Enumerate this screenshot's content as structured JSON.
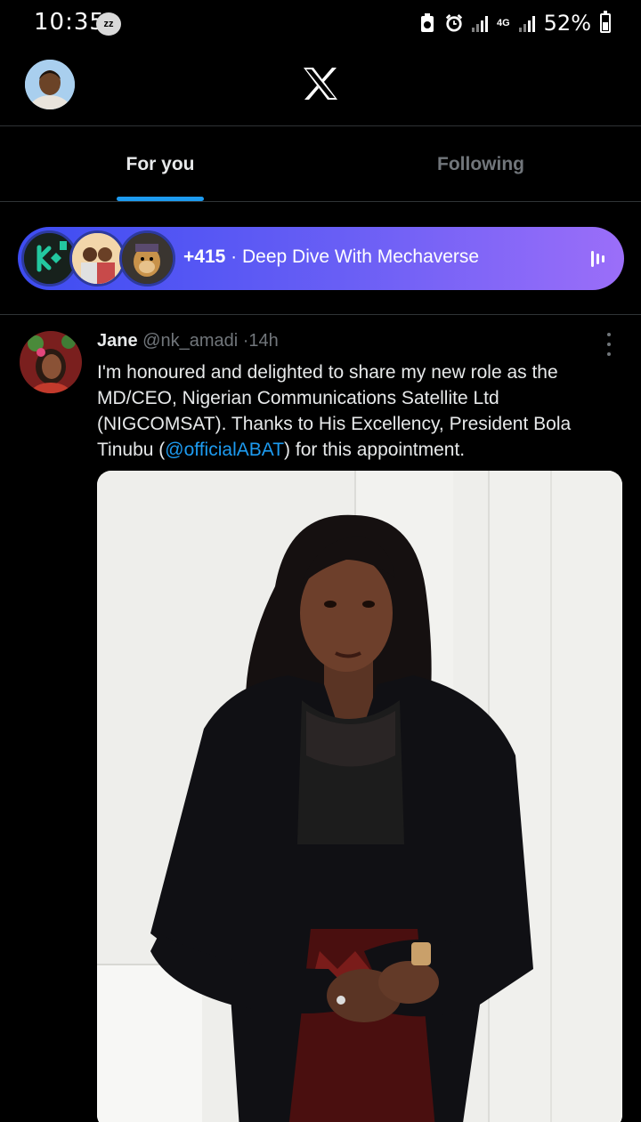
{
  "status_bar": {
    "time": "10:35",
    "zz_badge": "zz",
    "network": "4G",
    "battery": "52%",
    "battery_level": 0.52
  },
  "header": {
    "avatar_icon": "user-avatar",
    "logo_icon": "x-logo-icon"
  },
  "tabs": [
    {
      "label": "For you",
      "active": true
    },
    {
      "label": "Following",
      "active": false
    }
  ],
  "space": {
    "count": "+415",
    "separator": "·",
    "title": "Deep Dive With Mechaverse",
    "icon": "audio-wave-icon",
    "accent_from": "#3d4cf2",
    "accent_to": "#9b6ef9"
  },
  "tweet": {
    "name": "Jane",
    "handle": "@nk_amadi",
    "dot": "·",
    "time": "14h",
    "text_before": "I'm honoured and delighted to share my new role as the MD/CEO, Nigerian Communications Satellite Ltd (NIGCOMSAT). Thanks to His Excellency, President Bola Tinubu (",
    "mention": "@officialABAT",
    "text_after": ") for this appointment."
  },
  "colors": {
    "background": "#000000",
    "link": "#1d9bf0",
    "muted": "#71767b",
    "divider": "#2f3336"
  }
}
